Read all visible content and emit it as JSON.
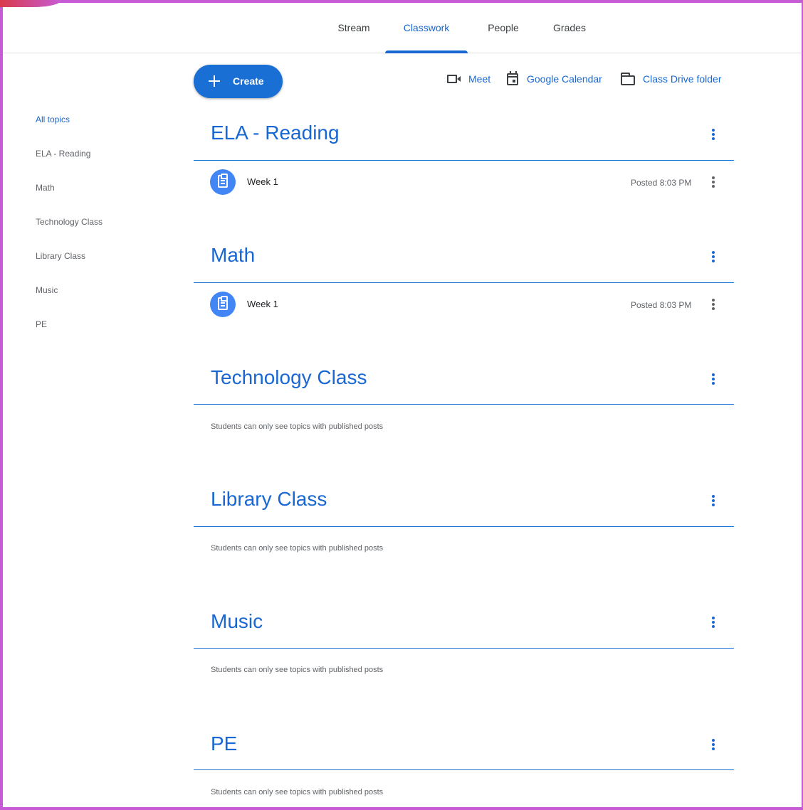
{
  "tabs": [
    {
      "label": "Stream",
      "active": false
    },
    {
      "label": "Classwork",
      "active": true
    },
    {
      "label": "People",
      "active": false
    },
    {
      "label": "Grades",
      "active": false
    }
  ],
  "sidebar": {
    "items": [
      {
        "label": "All topics",
        "active": true
      },
      {
        "label": "ELA - Reading",
        "active": false
      },
      {
        "label": "Math",
        "active": false
      },
      {
        "label": "Technology Class",
        "active": false
      },
      {
        "label": "Library Class",
        "active": false
      },
      {
        "label": "Music",
        "active": false
      },
      {
        "label": "PE",
        "active": false
      }
    ]
  },
  "toolbar": {
    "create_label": "Create",
    "links": [
      {
        "label": "Meet",
        "icon": "video-camera-icon"
      },
      {
        "label": "Google Calendar",
        "icon": "calendar-icon"
      },
      {
        "label": "Class Drive folder",
        "icon": "folder-icon"
      }
    ]
  },
  "topics": [
    {
      "title": "ELA - Reading",
      "items": [
        {
          "title": "Week 1",
          "posted": "Posted 8:03 PM",
          "icon": "assignment-icon"
        }
      ]
    },
    {
      "title": "Math",
      "items": [
        {
          "title": "Week 1",
          "posted": "Posted 8:03 PM",
          "icon": "assignment-icon"
        }
      ]
    },
    {
      "title": "Technology Class",
      "note": "Students can only see topics with published posts"
    },
    {
      "title": "Library Class",
      "note": "Students can only see topics with published posts"
    },
    {
      "title": "Music",
      "note": "Students can only see topics with published posts"
    },
    {
      "title": "PE",
      "note": "Students can only see topics with published posts"
    }
  ],
  "colors": {
    "accent": "#1967d2",
    "create_button": "#1a6fd5",
    "assignment_icon_bg": "#4285f4",
    "frame_border": "#c75bd6"
  }
}
